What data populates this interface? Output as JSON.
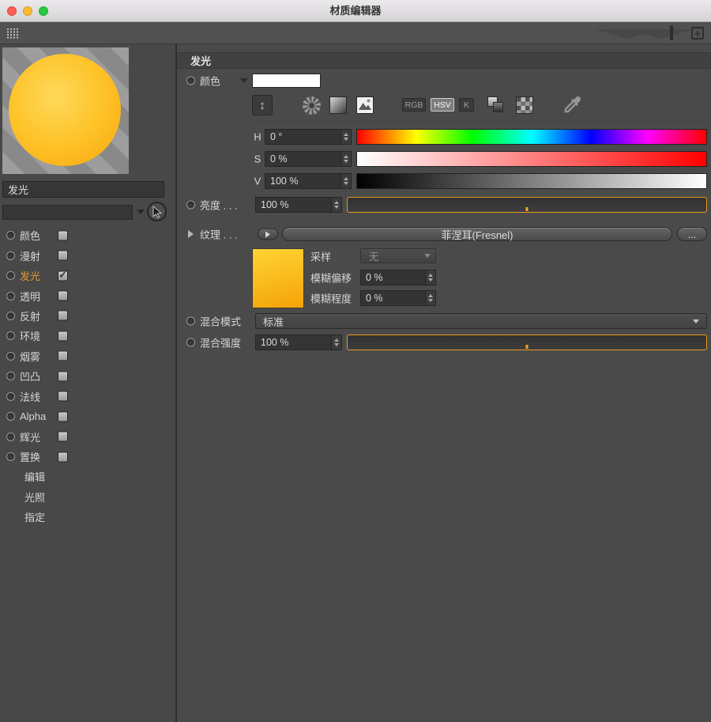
{
  "window": {
    "title": "材质编辑器"
  },
  "icons": {
    "plus": "+",
    "updown": "↕",
    "check": "✓"
  },
  "sidebar": {
    "material_name": "发光",
    "search_value": "",
    "channels": [
      {
        "label": "颜色",
        "checked": false,
        "active": false
      },
      {
        "label": "漫射",
        "checked": false,
        "active": false
      },
      {
        "label": "发光",
        "checked": true,
        "active": true
      },
      {
        "label": "透明",
        "checked": false,
        "active": false
      },
      {
        "label": "反射",
        "checked": false,
        "active": false
      },
      {
        "label": "环境",
        "checked": false,
        "active": false
      },
      {
        "label": "烟雾",
        "checked": false,
        "active": false
      },
      {
        "label": "凹凸",
        "checked": false,
        "active": false
      },
      {
        "label": "法线",
        "checked": false,
        "active": false
      },
      {
        "label": "Alpha",
        "checked": false,
        "active": false
      },
      {
        "label": "辉光",
        "checked": false,
        "active": false
      },
      {
        "label": "置换",
        "checked": false,
        "active": false
      }
    ],
    "extra_items": [
      {
        "label": "编辑"
      },
      {
        "label": "光照"
      },
      {
        "label": "指定"
      }
    ]
  },
  "main": {
    "section_title": "发光",
    "color_row": {
      "label": "颜色",
      "swatch_color": "#ffffff"
    },
    "picker": {
      "rgb_label": "RGB",
      "hsv_label": "HSV",
      "k_label": "K",
      "selected": "HSV"
    },
    "hsv_rows": [
      {
        "label": "H",
        "value": "0 °"
      },
      {
        "label": "S",
        "value": "0 %"
      },
      {
        "label": "V",
        "value": "100 %"
      }
    ],
    "brightness": {
      "label": "亮度 . . .",
      "value": "100 %"
    },
    "texture": {
      "label": "纹理 . . .",
      "shader": "菲涅耳(Fresnel)",
      "more_label": "..."
    },
    "texture_props": {
      "sampling_label": "采样",
      "sampling_value": "无",
      "blur_offset_label": "模糊偏移",
      "blur_offset_value": "0 %",
      "blur_scale_label": "模糊程度",
      "blur_scale_value": "0 %"
    },
    "mix_mode": {
      "label": "混合模式",
      "value": "标准"
    },
    "mix_strength": {
      "label": "混合强度",
      "value": "100 %"
    }
  },
  "colors": {
    "accent_orange": "#e8991f",
    "panel": "#4a4a4a",
    "field": "#343434",
    "active_channel": "#e39a2b"
  }
}
